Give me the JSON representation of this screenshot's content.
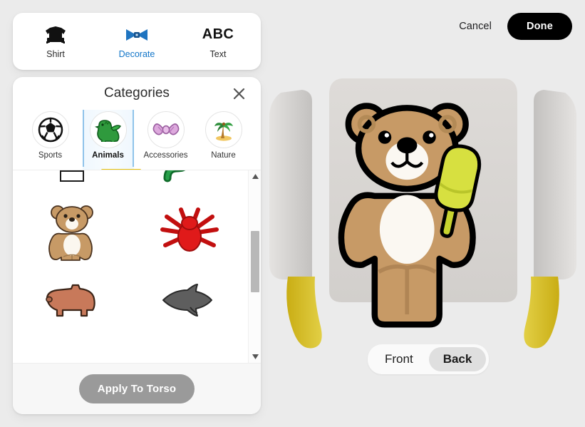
{
  "window": {
    "background_color": "#e9e9e9"
  },
  "top_actions": {
    "cancel_label": "Cancel",
    "done_label": "Done",
    "done_bg": "#000000"
  },
  "tabbar": {
    "tabs": [
      {
        "label": "Shirt",
        "icon": "shirt-icon",
        "active": false
      },
      {
        "label": "Decorate",
        "icon": "bowtie-icon",
        "active": true
      },
      {
        "label": "Text",
        "icon": "abc-icon",
        "glyph": "ABC",
        "active": false
      }
    ],
    "active_color": "#1275c8"
  },
  "categories_panel": {
    "title": "Categories",
    "close_icon": "close-icon",
    "selected_index": 1,
    "selection_color": "#8fc3ea",
    "items": [
      {
        "label": "Sports",
        "icon": "soccer-ball-icon"
      },
      {
        "label": "Animals",
        "icon": "dinosaur-icon"
      },
      {
        "label": "Accessories",
        "icon": "bow-icon"
      },
      {
        "label": "Nature",
        "icon": "palm-tree-icon"
      }
    ]
  },
  "sticker_grid": {
    "stickers": [
      {
        "name": "swan-sticker",
        "icon": "swan",
        "color": "#ffffff"
      },
      {
        "name": "snake-sticker",
        "icon": "snake",
        "color": "#11722f"
      },
      {
        "name": "teddy-bear-sticker",
        "icon": "bear",
        "color": "#c79a66"
      },
      {
        "name": "spider-sticker",
        "icon": "spider",
        "color": "#d71d1d"
      },
      {
        "name": "pig-sticker",
        "icon": "pig",
        "color": "#c87a58"
      },
      {
        "name": "shark-sticker",
        "icon": "shark",
        "color": "#5e5e5e"
      },
      {
        "name": "partial-sticker",
        "icon": "arc",
        "color": "#111111"
      }
    ],
    "scrollbar": {
      "up_icon": "caret-up-icon",
      "down_icon": "caret-down-icon"
    }
  },
  "apply": {
    "label": "Apply To Torso",
    "enabled": false,
    "bg": "#9a9a9a"
  },
  "view_toggle": {
    "options": [
      {
        "label": "Front",
        "active": false
      },
      {
        "label": "Back",
        "active": true
      }
    ],
    "active_bg": "#dfdfdf"
  },
  "preview": {
    "torso_color": "#d6d3d0",
    "arm_color": "#cfcdcb",
    "hand_color": "#d9c22b",
    "applied_decals": [
      {
        "name": "teddy-bear-decal",
        "color": "#c79a66"
      },
      {
        "name": "popsicle-decal",
        "color": "#d7e040"
      }
    ]
  }
}
